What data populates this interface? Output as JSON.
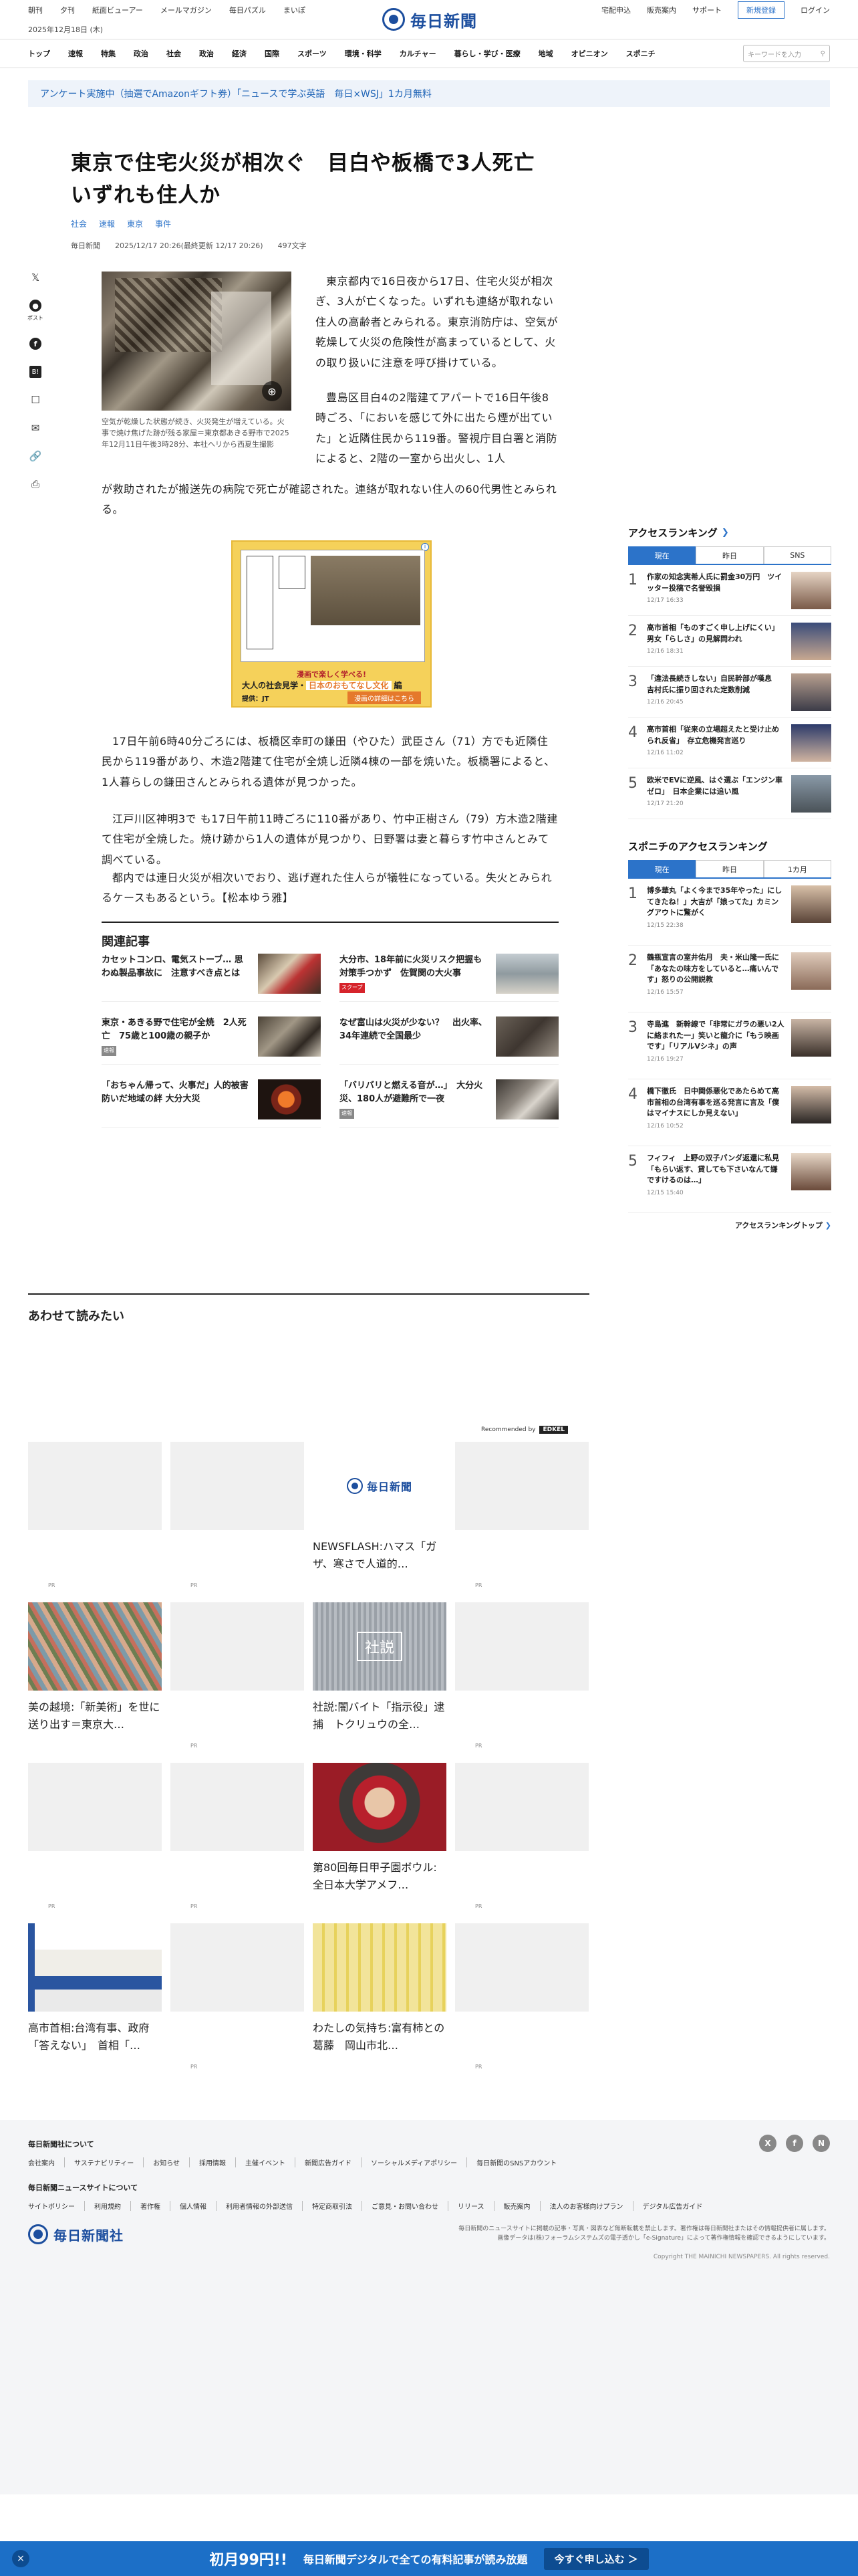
{
  "util": {
    "left": [
      "朝刊",
      "夕刊",
      "紙面ビューアー",
      "メールマガジン",
      "毎日パズル",
      "まいぽ"
    ],
    "right": [
      "宅配申込",
      "販売案内",
      "サポート"
    ],
    "register": "新規登録",
    "login": "ログイン"
  },
  "brand": "毎日新聞",
  "date": "2025年12月18日 (木)",
  "nav": {
    "items": [
      "トップ",
      "速報",
      "特集",
      "政治",
      "社会",
      "政治",
      "経済",
      "国際",
      "スポーツ",
      "環境・科学",
      "カルチャー",
      "暮らし・学び・医療",
      "地域",
      "オピニオン",
      "スポニチ"
    ],
    "search_placeholder": "キーワードを入力"
  },
  "banner": "アンケート実施中（抽選でAmazonギフト券）「ニュースで学ぶ英語　毎日×WSJ」1カ月無料",
  "article": {
    "title": "東京で住宅火災が相次ぐ　目白や板橋で3人死亡　いずれも住人か",
    "tags": [
      "社会",
      "速報",
      "東京",
      "事件"
    ],
    "source": "毎日新聞",
    "timestamp": "2025/12/17 20:26(最終更新 12/17 20:26)",
    "chars": "497文字",
    "share_label": "ポスト",
    "photo_caption": "空気が乾燥した状態が続き、火災発生が増えている。火事で焼け焦げた跡が残る家屋＝東京都あきる野市で2025年12月11日午後3時28分、本社ヘリから西夏生撮影",
    "p1": "東京都内で16日夜から17日、住宅火災が相次ぎ、3人が亡くなった。いずれも連絡が取れない住人の高齢者とみられる。東京消防庁は、空気が乾燥して火災の危険性が高まっているとして、火の取り扱いに注意を呼び掛けている。",
    "p2": "豊島区目白4の2階建てアパートで16日午後8時ごろ、「においを感じて外に出たら煙が出ていた」と近隣住民から119番。警視庁目白署と消防によると、2階の一室から出火し、1人",
    "p2b": "が救助されたが搬送先の病院で死亡が確認された。連絡が取れない住人の60代男性とみられる。",
    "p3": "17日午前6時40分ごろには、板橋区幸町の鎌田（やひた）武臣さん（71）方でも近隣住民から119番があり、木造2階建て住宅が全焼し近隣4棟の一部を焼いた。板橋署によると、1人暮らしの鎌田さんとみられる遺体が見つかった。",
    "p4": "江戸川区神明3で も17日午前11時ごろに110番があり、竹中正樹さん（79）方木造2階建て住宅が全焼した。焼け跡から1人の遺体が見つかり、日野署は妻と暮らす竹中さんとみて調べている。",
    "p5": "都内では連日火災が相次いでおり、逃げ遅れた住人らが犠牲になっている。失火とみられるケースもあるという。【松本ゆう雅】"
  },
  "ad": {
    "top": "漫画で楽しく学べる!",
    "line": "大人の社会見学・",
    "highlight": "日本のおもてなし文化",
    "suffix": "編",
    "sponsor": "提供：JT",
    "cta": "漫画の詳細はこちら",
    "info": "i"
  },
  "related": {
    "title": "関連記事",
    "items": [
      {
        "text": "カセットコンロ、電気ストーブ… 思わぬ製品事故に　注意すべき点とは",
        "badge": ""
      },
      {
        "text": "大分市、18年前に火災リスク把握も対策手つかず　佐賀関の大火事",
        "badge": "スクープ"
      },
      {
        "text": "東京・あきる野で住宅が全焼　2人死亡　75歳と100歳の親子か",
        "badge": "速報"
      },
      {
        "text": "なぜ富山は火災が少ない？　出火率、34年連続で全国最少",
        "badge": ""
      },
      {
        "text": "「おちゃん帰って、火事だ」人的被害防いだ地域の絆 大分大災",
        "badge": ""
      },
      {
        "text": "「バリバリと燃える音が…」　大分火災、180人が避難所で一夜",
        "badge": "速報"
      }
    ]
  },
  "more": {
    "title": "あわせて読みたい",
    "recommended_by": "Recommended by",
    "recommended_brand": "EDKEL",
    "pr": "PR",
    "cards": [
      {
        "text": ""
      },
      {
        "text": ""
      },
      {
        "text": "NEWSFLASH:ハマス「ガザ、寒さで人道的…"
      },
      {
        "text": ""
      },
      {
        "text": "美の越境:「新美術」を世に送り出す＝東京大…"
      },
      {
        "text": ""
      },
      {
        "text": "社説:闇バイト「指示役」逮捕　トクリュウの全…"
      },
      {
        "text": ""
      },
      {
        "text": ""
      },
      {
        "text": ""
      },
      {
        "text": "第80回毎日甲子園ボウル:全日本大学アメフ…"
      },
      {
        "text": ""
      },
      {
        "text": "高市首相:台湾有事、政府「答えない」　首相「…"
      },
      {
        "text": ""
      },
      {
        "text": "わたしの気持ち:富有柿との葛藤　岡山市北…"
      },
      {
        "text": ""
      }
    ],
    "edit_mark": "社説"
  },
  "sidebar": {
    "access_title": "アクセスランキング",
    "tabs": [
      "現在",
      "昨日",
      "SNS"
    ],
    "ranks": [
      {
        "n": "1",
        "text": "作家の知念実希人氏に罰金30万円　ツイッター投稿で名誉毀損",
        "time": "12/17 16:33"
      },
      {
        "n": "2",
        "text": "高市首相「ものすごく申し上げにくい」　男女「らしさ」の見解問われ",
        "time": "12/16 18:31"
      },
      {
        "n": "3",
        "text": "「違法長続きしない」自民幹部が嘆息　吉村氏に振り回された定数削減",
        "time": "12/16 20:45"
      },
      {
        "n": "4",
        "text": "高市首相「従来の立場超えたと受け止められ反省」　存立危機発言巡り",
        "time": "12/16 11:02"
      },
      {
        "n": "5",
        "text": "欧米でEVに逆風、はぐ選ぶ「エンジン車ゼロ」　日本企業には追い風",
        "time": "12/17 21:20"
      }
    ],
    "sponichi_title": "スポニチのアクセスランキング",
    "sponichi_tabs": [
      "現在",
      "昨日",
      "1カ月"
    ],
    "sponichi_ranks": [
      {
        "n": "1",
        "text": "博多華丸「よく今まで35年やった」にしてきたね！」大吉が「娘ってた」カミングアウトに驚がく",
        "time": "12/15 22:38"
      },
      {
        "n": "2",
        "text": "鶴瓶宣言の室井佑月　夫・米山隆一氏に「あなたの味方をしていると…痛いんです」怒りの公開説教",
        "time": "12/16 15:57"
      },
      {
        "n": "3",
        "text": "寺島進　新幹線で「非常にガラの悪い2人に絡まれた一」笑いと龍介に「もう映画です」「リアルVシネ」の声",
        "time": "12/16 19:27"
      },
      {
        "n": "4",
        "text": "橋下徹氏　日中関係悪化であたらめて高市首相の台湾有事を巡る発言に言及「僕はマイナスにしか見えない」",
        "time": "12/16 10:52"
      },
      {
        "n": "5",
        "text": "フィフィ　上野の双子パンダ返還に私見「もらい返す、貸しても下さいなんて嫌ですけるのは…」",
        "time": "12/15 15:40"
      }
    ],
    "ranking_top": "アクセスランキングトップ"
  },
  "footer": {
    "s1": "毎日新聞社について",
    "row1": [
      "会社案内",
      "サステナビリティー",
      "お知らせ",
      "採用情報",
      "主催イベント",
      "新聞広告ガイド",
      "ソーシャルメディアポリシー",
      "毎日新聞のSNSアカウント"
    ],
    "s2": "毎日新聞ニュースサイトについて",
    "row2": [
      "サイトポリシー",
      "利用規約",
      "著作権",
      "個人情報",
      "利用者情報の外部送信",
      "特定商取引法",
      "ご意見・お問い合わせ",
      "リリース",
      "販売案内",
      "法人のお客様向けプラン",
      "デジタル広告ガイド"
    ],
    "sns": [
      "X",
      "f",
      "N"
    ],
    "logo": "毎日新聞社",
    "notice": "毎日新聞のニュースサイトに掲載の記事・写真・図表など無断転載を禁止します。著作権は毎日新聞社またはその情報提供者に属します。画像データは(株)フォーラムシステムズの電子透かし「e-Signature」によって著作権情報を確認できるようにしています。",
    "copyright": "Copyright THE MAINICHI NEWSPAPERS. All rights reserved."
  },
  "bottom_bar": {
    "close": "×",
    "offer": "初月99円!!",
    "text": "毎日新聞デジタルで全ての有料記事が読み放題",
    "cta": "今すぐ申し込む ＞"
  },
  "colors": {
    "brand_blue": "#1c4e9e",
    "accent_blue": "#2c73c9",
    "badge_red": "#d6232b"
  }
}
